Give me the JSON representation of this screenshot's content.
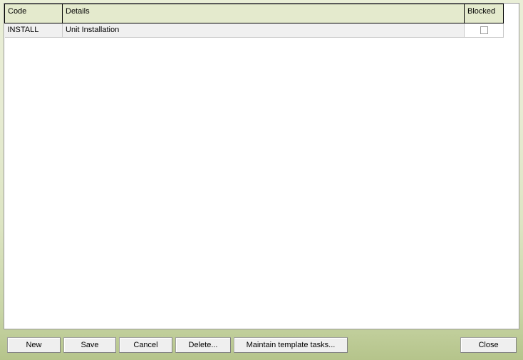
{
  "window": {
    "background_top_color": "#e9eed6",
    "background_bottom_color": "#b5c48b"
  },
  "grid": {
    "header_background": "#e4eacd",
    "row_background": "#f0f0f0",
    "columns": [
      {
        "key": "code",
        "label": "Code"
      },
      {
        "key": "details",
        "label": "Details"
      },
      {
        "key": "blocked",
        "label": "Blocked"
      }
    ],
    "rows": [
      {
        "code": "INSTALL",
        "details": "Unit Installation",
        "blocked": false
      }
    ]
  },
  "footer": {
    "buttons": [
      {
        "key": "new",
        "label": "New"
      },
      {
        "key": "save",
        "label": "Save"
      },
      {
        "key": "cancel",
        "label": "Cancel"
      },
      {
        "key": "delete",
        "label": "Delete..."
      },
      {
        "key": "maintain",
        "label": "Maintain template tasks..."
      },
      {
        "key": "close",
        "label": "Close"
      }
    ]
  }
}
